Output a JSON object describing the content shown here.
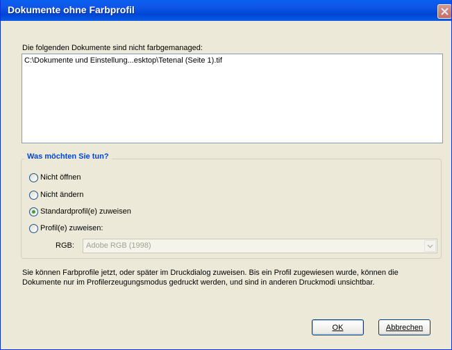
{
  "window": {
    "title": "Dokumente ohne Farbprofil"
  },
  "documents": {
    "label": "Die folgenden Dokumente sind nicht farbgemanaged:",
    "items": [
      "C:\\Dokumente und Einstellung...esktop\\Tetenal (Seite 1).tif"
    ]
  },
  "action_group": {
    "legend": "Was möchten Sie tun?",
    "options": [
      {
        "label": "Nicht öffnen",
        "checked": false
      },
      {
        "label": "Nicht ändern",
        "checked": false
      },
      {
        "label": "Standardprofil(e) zuweisen",
        "checked": true
      },
      {
        "label": "Profil(e) zuweisen:",
        "checked": false
      }
    ],
    "rgb": {
      "label": "RGB:",
      "value": "Adobe RGB (1998)",
      "enabled": false
    }
  },
  "info_text": "Sie können Farbprofile jetzt, oder später im Druckdialog zuweisen. Bis ein Profil zugewiesen wurde, können die Dokumente nur im Profilerzeugungsmodus gedruckt werden, und sind in anderen Druckmodi unsichtbar.",
  "buttons": {
    "ok": "OK",
    "cancel": "Abbrechen"
  }
}
